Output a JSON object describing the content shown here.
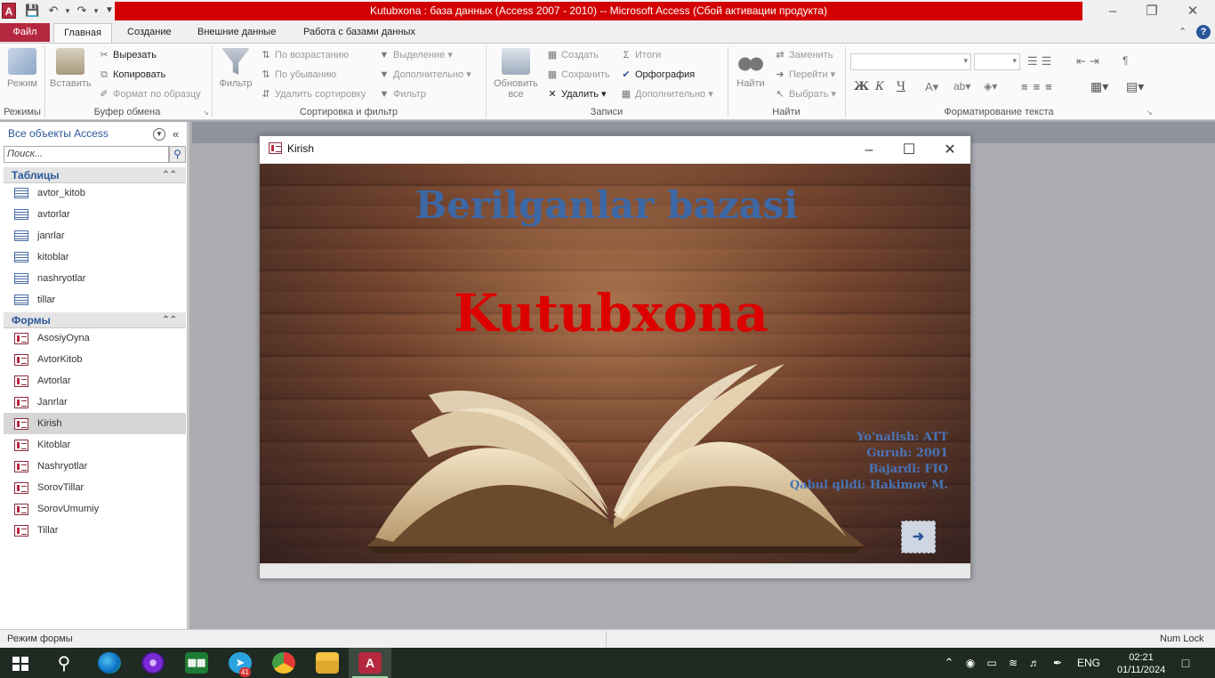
{
  "window": {
    "title": "Kutubxona : база данных (Access 2007 - 2010) -- Microsoft Access (Сбой активации продукта)",
    "app_icon_letter": "A",
    "accent": "#d20000"
  },
  "tabs": [
    "Файл",
    "Главная",
    "Создание",
    "Внешние данные",
    "Работа с базами данных"
  ],
  "ribbon": {
    "modes": {
      "view_label": "Режим",
      "group": "Режимы"
    },
    "clipboard": {
      "paste_label": "Вставить",
      "cut": "Вырезать",
      "copy": "Копировать",
      "format_painter": "Формат по образцу",
      "group": "Буфер обмена"
    },
    "sort_filter": {
      "filter_label": "Фильтр",
      "ascending": "По возрастанию",
      "descending": "По убыванию",
      "remove_sort": "Удалить сортировку",
      "selection": "Выделение",
      "advanced": "Дополнительно",
      "toggle_filter": "Фильтр",
      "group": "Сортировка и фильтр"
    },
    "records": {
      "refresh_label": "Обновить все",
      "new": "Создать",
      "save": "Сохранить",
      "delete": "Удалить",
      "totals": "Итоги",
      "spelling": "Орфография",
      "more": "Дополнительно",
      "group": "Записи"
    },
    "find": {
      "find_label": "Найти",
      "replace": "Заменить",
      "goto": "Перейти",
      "select": "Выбрать",
      "group": "Найти"
    },
    "text_format": {
      "bold": "Ж",
      "italic": "К",
      "underline": "Ч",
      "group": "Форматирование текста"
    }
  },
  "nav": {
    "header": "Все объекты Access",
    "search_placeholder": "Поиск...",
    "tables_header": "Таблицы",
    "tables": [
      "avtor_kitob",
      "avtorlar",
      "janrlar",
      "kitoblar",
      "nashryotlar",
      "tillar"
    ],
    "forms_header": "Формы",
    "forms": [
      "AsosiyOyna",
      "AvtorKitob",
      "Avtorlar",
      "Janrlar",
      "Kirish",
      "Kitoblar",
      "Nashryotlar",
      "SorovTillar",
      "SorovUmumiy",
      "Tillar"
    ],
    "selected_form": "Kirish"
  },
  "form": {
    "title": "Kirish",
    "heading": "Berilganlar bazasi",
    "main_title": "Kutubxona",
    "info": [
      "Yo'nalish: ATT",
      "Guruh: 2001",
      "Bajardi: FIO",
      "Qabul qildi: Hakimov M."
    ],
    "next_button_icon": "arrow-right-icon"
  },
  "status": {
    "left": "Режим формы",
    "right": "Num Lock"
  },
  "taskbar": {
    "lang": "ENG",
    "time": "02:21",
    "date": "01/11/2024",
    "telegram_badge": "41"
  }
}
